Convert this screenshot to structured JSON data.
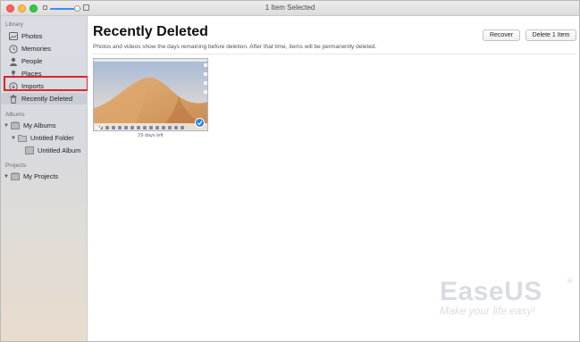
{
  "window": {
    "title": "1 Item Selected"
  },
  "sidebar": {
    "library_header": "Library",
    "library_items": [
      {
        "label": "Photos",
        "icon": "photos-icon"
      },
      {
        "label": "Memories",
        "icon": "memories-icon"
      },
      {
        "label": "People",
        "icon": "people-icon"
      },
      {
        "label": "Places",
        "icon": "places-icon"
      },
      {
        "label": "Imports",
        "icon": "imports-icon"
      },
      {
        "label": "Recently Deleted",
        "icon": "trash-icon",
        "selected": true
      }
    ],
    "albums_header": "Albums",
    "albums": [
      {
        "label": "My Albums"
      },
      {
        "label": "Untitled Folder"
      },
      {
        "label": "Untitled Album"
      }
    ],
    "projects_header": "Projects",
    "projects": [
      {
        "label": "My Projects"
      }
    ]
  },
  "main": {
    "title": "Recently Deleted",
    "subtitle": "Photos and videos show the days remaining before deletion. After that time, items will be permanently deleted.",
    "recover_label": "Recover",
    "delete_label": "Delete 1 Item",
    "items": [
      {
        "caption": "29 days left",
        "selected": true
      }
    ]
  },
  "watermark": {
    "brand": "EaseUS",
    "registered": "®",
    "tagline": "Make your life easy!"
  },
  "colors": {
    "accent": "#3b8cf5",
    "highlight_box": "#d9262c",
    "selected_row": "#c8cdd6"
  }
}
